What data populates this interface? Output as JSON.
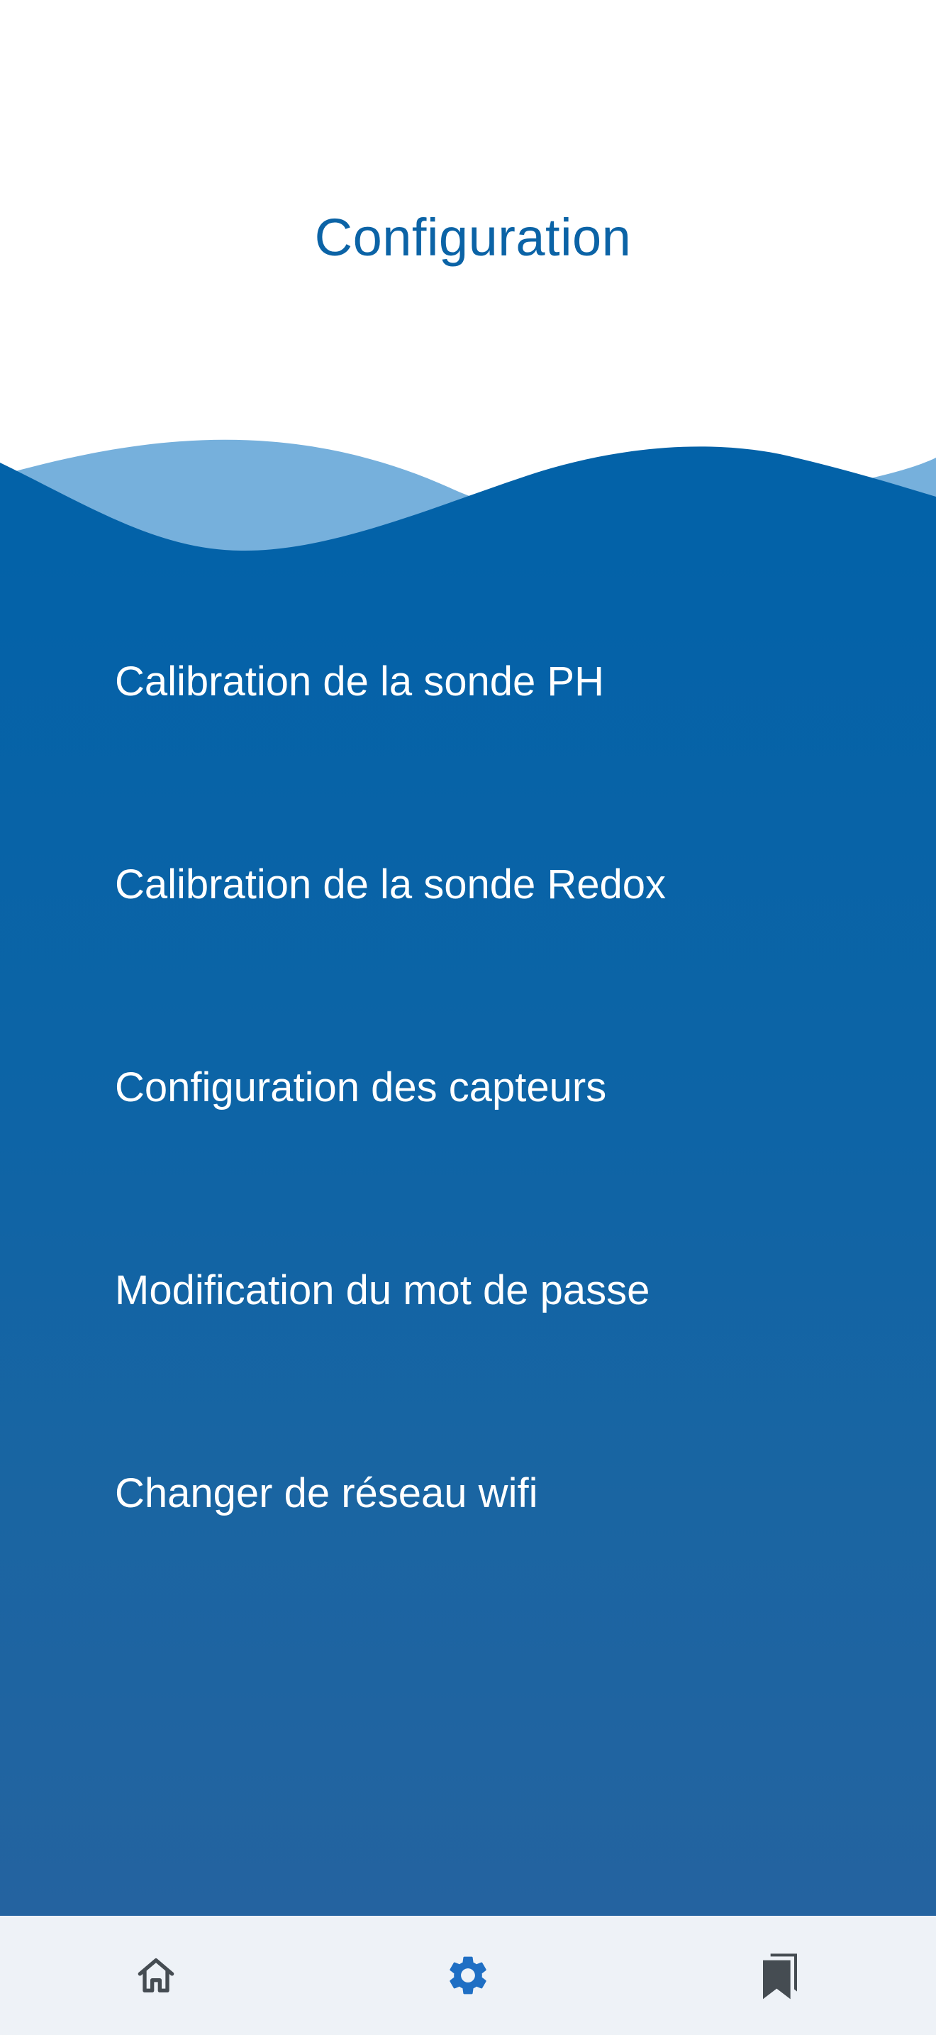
{
  "header": {
    "title": "Configuration"
  },
  "menu": {
    "items": [
      {
        "label": "Calibration de la sonde PH"
      },
      {
        "label": "Calibration de la sonde Redox"
      },
      {
        "label": "Configuration des capteurs"
      },
      {
        "label": "Modification du mot de passe"
      },
      {
        "label": "Changer de réseau wifi"
      }
    ]
  },
  "bottom_nav": {
    "items": [
      {
        "icon": "home-icon",
        "active": false
      },
      {
        "icon": "gear-icon",
        "active": true
      },
      {
        "icon": "bookmarks-icon",
        "active": false
      }
    ]
  },
  "colors": {
    "primary": "#0362a8",
    "primary_bottom": "#2463a0",
    "wave_light": "#76b0dc",
    "title": "#0b63a6",
    "nav_bg": "#eef2f7",
    "nav_icon_inactive": "#454c52",
    "nav_icon_active": "#1f6fc4"
  }
}
